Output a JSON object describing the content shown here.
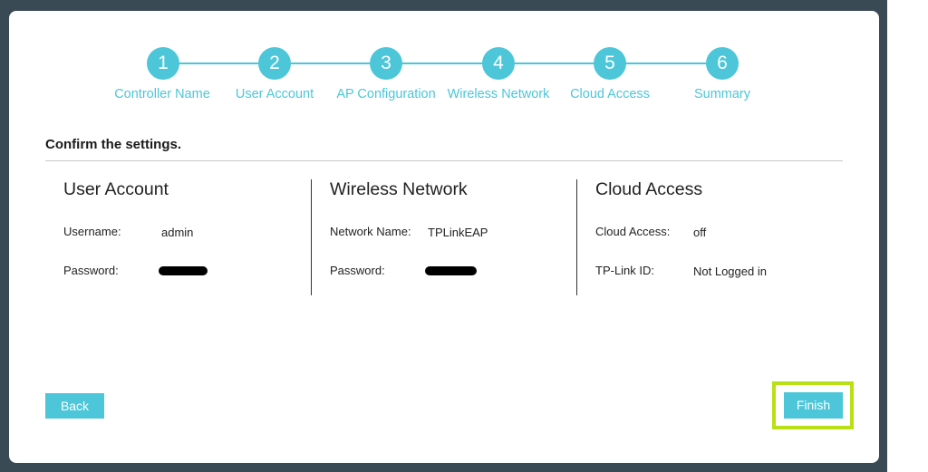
{
  "steps": [
    {
      "number": "1",
      "label": "Controller Name"
    },
    {
      "number": "2",
      "label": "User Account"
    },
    {
      "number": "3",
      "label": "AP Configuration"
    },
    {
      "number": "4",
      "label": "Wireless Network"
    },
    {
      "number": "5",
      "label": "Cloud Access"
    },
    {
      "number": "6",
      "label": "Summary"
    }
  ],
  "confirm_title": "Confirm the settings.",
  "sections": {
    "user_account": {
      "title": "User Account",
      "username_label": "Username:",
      "username_value": "admin",
      "password_label": "Password:"
    },
    "wireless_network": {
      "title": "Wireless Network",
      "network_name_label": "Network Name:",
      "network_name_value": "TPLinkEAP",
      "password_label": "Password:"
    },
    "cloud_access": {
      "title": "Cloud Access",
      "cloud_access_label": "Cloud Access:",
      "cloud_access_value": "off",
      "tplink_id_label": "TP-Link ID:",
      "tplink_id_value": "Not Logged in"
    }
  },
  "buttons": {
    "back": "Back",
    "finish": "Finish"
  },
  "colors": {
    "accent": "#4cc6d8",
    "highlight": "#b9e014",
    "backdrop": "#3a4a54"
  }
}
